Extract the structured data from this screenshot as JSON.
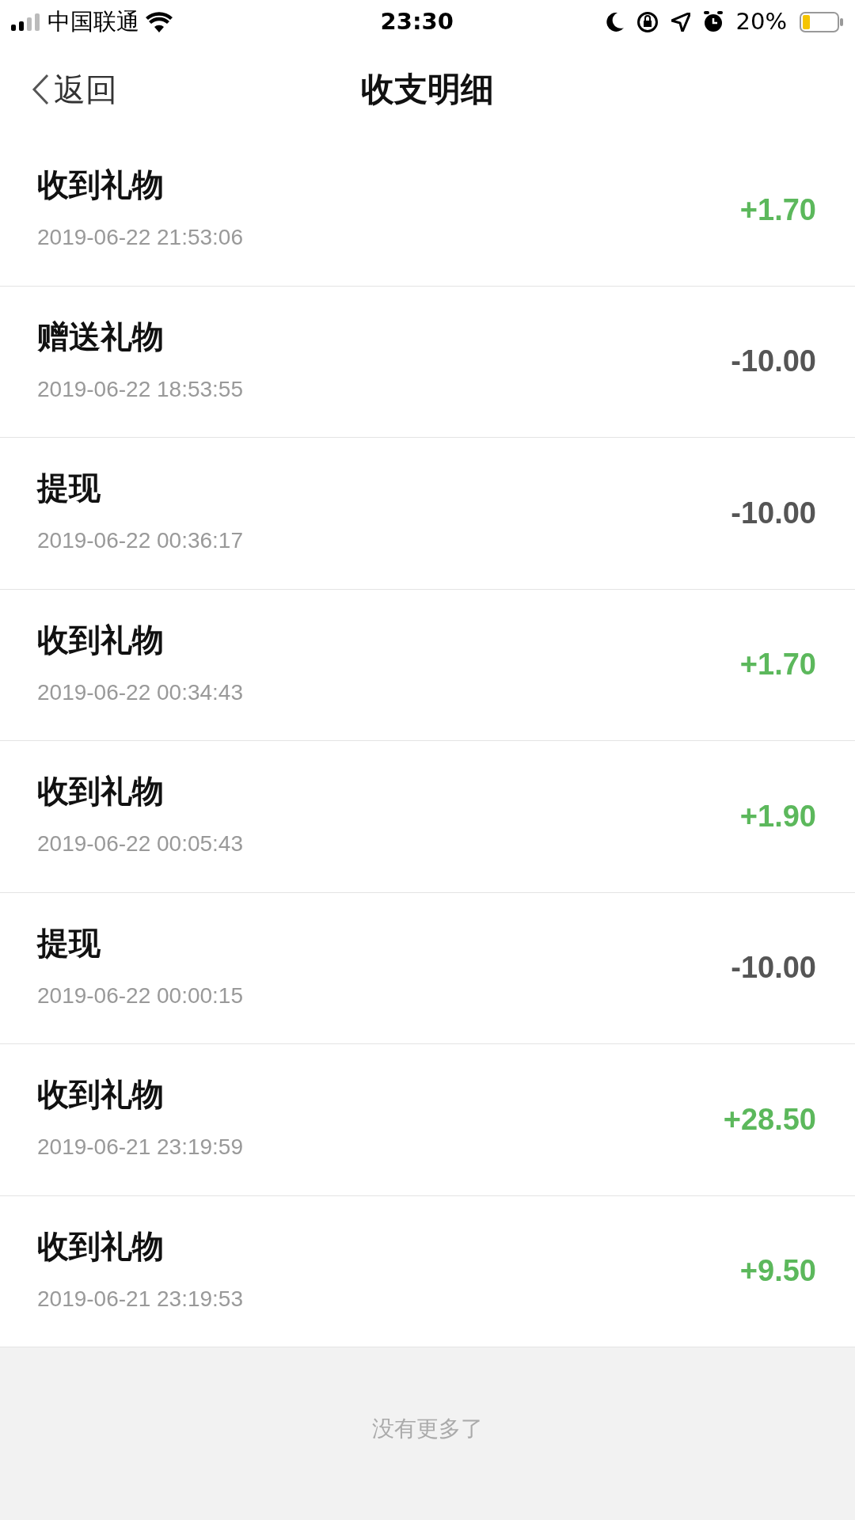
{
  "status_bar": {
    "carrier": "中国联通",
    "time": "23:30",
    "battery": "20%"
  },
  "nav": {
    "back": "返回",
    "title": "收支明细"
  },
  "records": [
    {
      "title": "收到礼物",
      "time": "2019-06-22 21:53:06",
      "amount": "+1.70",
      "kind": "income"
    },
    {
      "title": "赠送礼物",
      "time": "2019-06-22 18:53:55",
      "amount": "-10.00",
      "kind": "expense"
    },
    {
      "title": "提现",
      "time": "2019-06-22 00:36:17",
      "amount": "-10.00",
      "kind": "expense"
    },
    {
      "title": "收到礼物",
      "time": "2019-06-22 00:34:43",
      "amount": "+1.70",
      "kind": "income"
    },
    {
      "title": "收到礼物",
      "time": "2019-06-22 00:05:43",
      "amount": "+1.90",
      "kind": "income"
    },
    {
      "title": "提现",
      "time": "2019-06-22 00:00:15",
      "amount": "-10.00",
      "kind": "expense"
    },
    {
      "title": "收到礼物",
      "time": "2019-06-21 23:19:59",
      "amount": "+28.50",
      "kind": "income"
    },
    {
      "title": "收到礼物",
      "time": "2019-06-21 23:19:53",
      "amount": "+9.50",
      "kind": "income"
    }
  ],
  "footer": "没有更多了"
}
